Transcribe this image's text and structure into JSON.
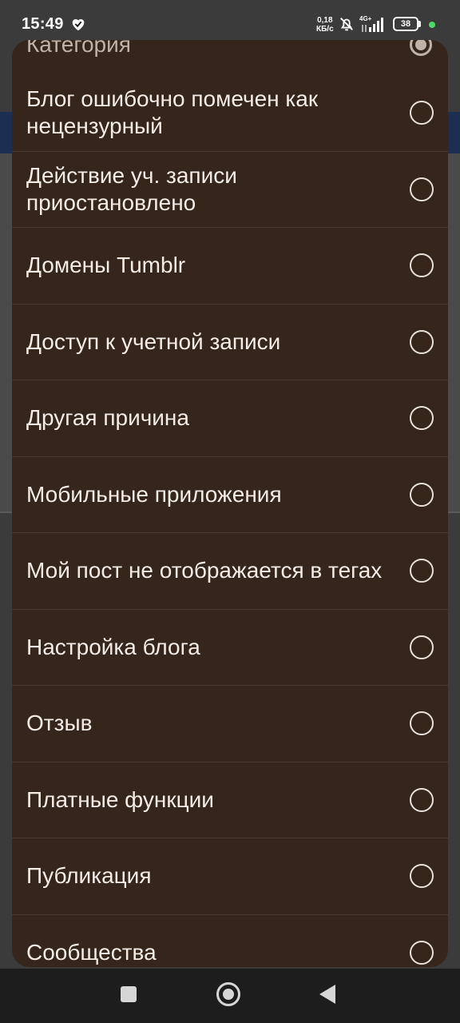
{
  "status_bar": {
    "time": "15:49",
    "net_speed_value": "0,18",
    "net_speed_unit": "КБ/с",
    "network_type": "4G+",
    "battery_level": "38",
    "icons": [
      "heart-icon",
      "bell-off-icon",
      "signal-icon",
      "battery-icon"
    ]
  },
  "dialog": {
    "title": "Категория",
    "options": [
      {
        "label": "Блог ошибочно помечен как нецензурный",
        "selected": false
      },
      {
        "label": "Действие уч. записи приостановлено",
        "selected": false
      },
      {
        "label": "Домены Tumblr",
        "selected": false
      },
      {
        "label": "Доступ к учетной записи",
        "selected": false
      },
      {
        "label": "Другая причина",
        "selected": false
      },
      {
        "label": "Мобильные приложения",
        "selected": false
      },
      {
        "label": "Мой пост не отображается в тегах",
        "selected": false
      },
      {
        "label": "Настройка блога",
        "selected": false
      },
      {
        "label": "Отзыв",
        "selected": false
      },
      {
        "label": "Платные функции",
        "selected": false
      },
      {
        "label": "Публикация",
        "selected": false
      },
      {
        "label": "Сообщества",
        "selected": false
      }
    ]
  },
  "colors": {
    "dialog_bg": "#35251a",
    "divider": "#4c3a2e",
    "text": "#f3ece6",
    "status_dot": "#4cd964"
  }
}
